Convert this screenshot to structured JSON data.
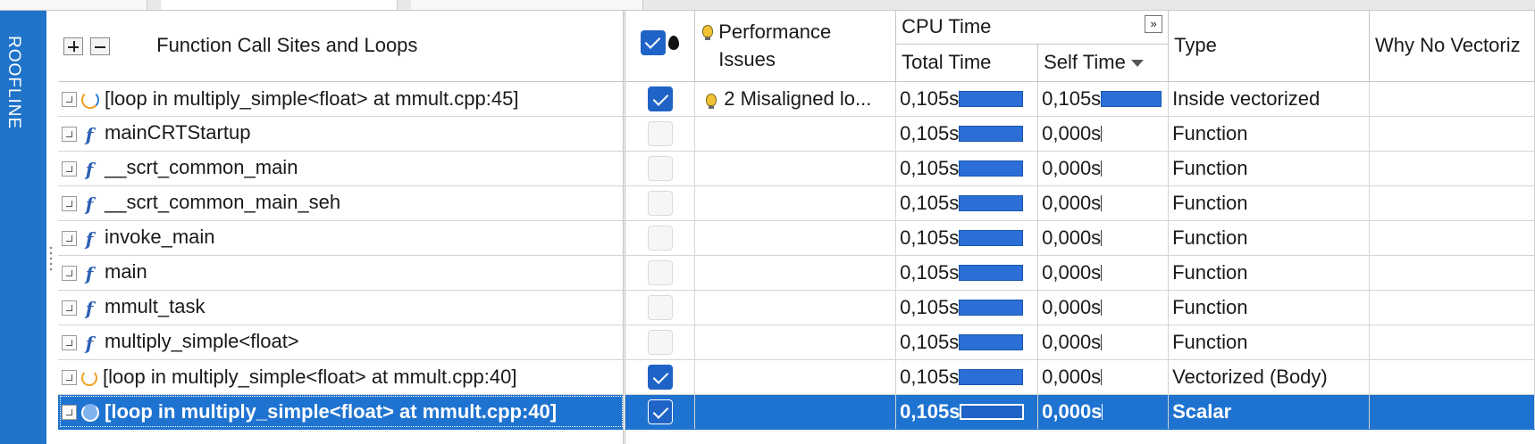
{
  "sidebar": {
    "label": "ROOFLINE"
  },
  "columns": {
    "function": "Function Call Sites and Loops",
    "perf_issues_line1": "Performance",
    "perf_issues_line2": "Issues",
    "cpu_time": "CPU Time",
    "total_time": "Total Time",
    "self_time": "Self Time",
    "type": "Type",
    "why_no_vec": "Why No Vectoriz"
  },
  "rows": [
    {
      "name": "[loop in multiply_simple<float> at mmult.cpp:45]",
      "icon": "loop-vectorized-icon",
      "checked": true,
      "issue": "2 Misaligned lo...",
      "total": "0,105s",
      "total_frac": 1.0,
      "self": "0,105s",
      "self_frac": 1.0,
      "type": "Inside vectorized"
    },
    {
      "name": "mainCRTStartup",
      "icon": "function-icon",
      "checked": false,
      "issue": "",
      "total": "0,105s",
      "total_frac": 1.0,
      "self": "0,000s",
      "self_frac": 0.0,
      "type": "Function"
    },
    {
      "name": "__scrt_common_main",
      "icon": "function-icon",
      "checked": false,
      "issue": "",
      "total": "0,105s",
      "total_frac": 1.0,
      "self": "0,000s",
      "self_frac": 0.0,
      "type": "Function"
    },
    {
      "name": "__scrt_common_main_seh",
      "icon": "function-icon",
      "checked": false,
      "issue": "",
      "total": "0,105s",
      "total_frac": 1.0,
      "self": "0,000s",
      "self_frac": 0.0,
      "type": "Function"
    },
    {
      "name": "invoke_main",
      "icon": "function-icon",
      "checked": false,
      "issue": "",
      "total": "0,105s",
      "total_frac": 1.0,
      "self": "0,000s",
      "self_frac": 0.0,
      "type": "Function"
    },
    {
      "name": "main",
      "icon": "function-icon",
      "checked": false,
      "issue": "",
      "total": "0,105s",
      "total_frac": 1.0,
      "self": "0,000s",
      "self_frac": 0.0,
      "type": "Function"
    },
    {
      "name": "mmult_task",
      "icon": "function-icon",
      "checked": false,
      "issue": "",
      "total": "0,105s",
      "total_frac": 1.0,
      "self": "0,000s",
      "self_frac": 0.0,
      "type": "Function"
    },
    {
      "name": "multiply_simple<float>",
      "icon": "function-icon",
      "checked": false,
      "issue": "",
      "total": "0,105s",
      "total_frac": 1.0,
      "self": "0,000s",
      "self_frac": 0.0,
      "type": "Function"
    },
    {
      "name": "[loop in multiply_simple<float> at mmult.cpp:40]",
      "icon": "loop-icon",
      "checked": true,
      "issue": "",
      "total": "0,105s",
      "total_frac": 1.0,
      "self": "0,000s",
      "self_frac": 0.0,
      "type": "Vectorized (Body)"
    },
    {
      "name": "[loop in multiply_simple<float> at mmult.cpp:40]",
      "icon": "loop-scalar-icon",
      "checked": true,
      "issue": "",
      "total": "0,105s",
      "total_frac": 1.0,
      "self": "0,000s",
      "self_frac": 0.0,
      "type": "Scalar",
      "selected": true
    }
  ]
}
